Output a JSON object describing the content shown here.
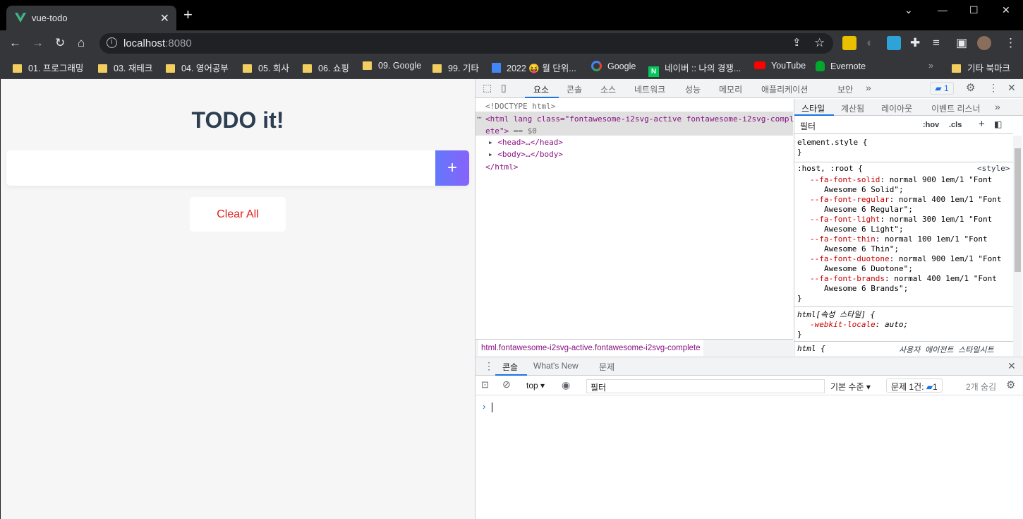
{
  "browser": {
    "tab_title": "vue-todo",
    "url_host": "localhost",
    "url_port": ":8080"
  },
  "bookmarks": [
    {
      "label": "01. 프로그래밍",
      "icon": "folder-icon"
    },
    {
      "label": "03. 재테크",
      "icon": "folder-icon"
    },
    {
      "label": "04. 영어공부",
      "icon": "folder-icon"
    },
    {
      "label": "05. 회사",
      "icon": "folder-icon"
    },
    {
      "label": "06. 쇼핑",
      "icon": "folder-icon"
    },
    {
      "label": "09. Google",
      "icon": "folder-icon"
    },
    {
      "label": "99. 기타",
      "icon": "folder-icon"
    },
    {
      "label": "2022 😝 월 단위...",
      "icon": "docs-icon"
    },
    {
      "label": "Google",
      "icon": "google-icon"
    },
    {
      "label": "네이버 :: 나의 경쟁...",
      "icon": "naver-icon"
    },
    {
      "label": "YouTube",
      "icon": "youtube-icon"
    },
    {
      "label": "Evernote",
      "icon": "evernote-icon"
    },
    {
      "label": "기타 북마크",
      "icon": "folder-icon"
    }
  ],
  "page": {
    "title": "TODO it!",
    "input_value": "",
    "add_label": "+",
    "clear_label": "Clear All"
  },
  "devtools": {
    "tabs": [
      "요소",
      "콘솔",
      "소스",
      "네트워크",
      "성능",
      "메모리",
      "애플리케이션",
      "보안"
    ],
    "issues_count": "1",
    "elements": {
      "doctype": "<!DOCTYPE html>",
      "html_open_1": "<html lang class=\"fontawesome-i2svg-active fontawesome-i2svg-complete\">",
      "html_eq": "== $0",
      "head": "<head>…</head>",
      "body": "<body>…</body>",
      "html_close": "</html>"
    },
    "breadcrumb": "html.fontawesome-i2svg-active.fontawesome-i2svg-complete",
    "styles_tabs": [
      "스타일",
      "계산됨",
      "레이아웃",
      "이벤트 리스너"
    ],
    "styles_filter": "필터",
    "hov": ":hov",
    "cls": ".cls",
    "styles": {
      "element_style": "element.style {",
      "close": "}",
      "root_selector": ":host, :root {",
      "root_source": "<style>",
      "vars": [
        {
          "name": "--fa-font-solid",
          "value": "normal 900 1em/1 \"Font",
          "value2": "Awesome 6 Solid\";"
        },
        {
          "name": "--fa-font-regular",
          "value": "normal 400 1em/1 \"Font",
          "value2": "Awesome 6 Regular\";"
        },
        {
          "name": "--fa-font-light",
          "value": "normal 300 1em/1 \"Font",
          "value2": "Awesome 6 Light\";"
        },
        {
          "name": "--fa-font-thin",
          "value": "normal 100 1em/1 \"Font",
          "value2": "Awesome 6 Thin\";"
        },
        {
          "name": "--fa-font-duotone",
          "value": "normal 900 1em/1 \"Font",
          "value2": "Awesome 6 Duotone\";"
        },
        {
          "name": "--fa-font-brands",
          "value": "normal 400 1em/1 \"Font",
          "value2": "Awesome 6 Brands\";"
        }
      ],
      "attr_style": "html[속성 스타일] {",
      "webkit_prop": "-webkit-locale",
      "webkit_val": "auto;",
      "ua_selector": "html {",
      "ua_source": "사용자 에이전트 스타일시트"
    },
    "drawer": {
      "tabs": [
        "콘솔",
        "What's New",
        "문제"
      ],
      "context": "top",
      "filter": "필터",
      "level": "기본 수준",
      "issues": "문제 1건:",
      "issues_count": "1",
      "hidden": "2개 숨김",
      "prompt": "›"
    }
  }
}
